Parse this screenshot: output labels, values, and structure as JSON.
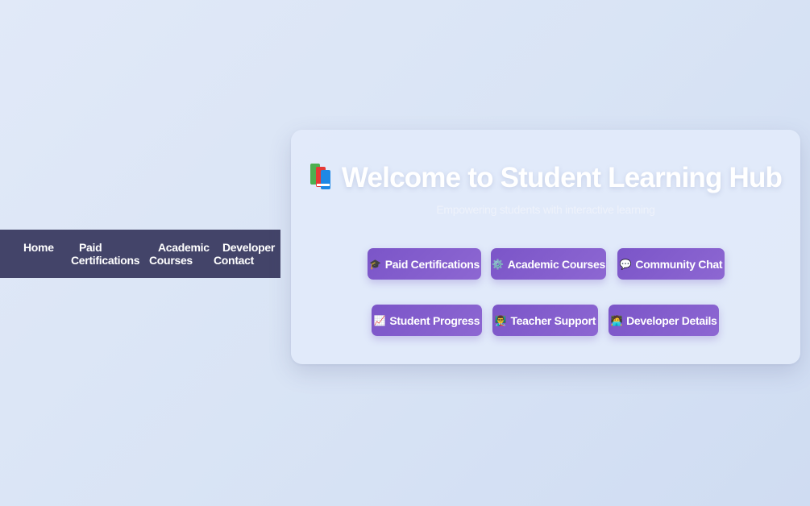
{
  "nav": {
    "home": "Home",
    "paid_line1": "Paid",
    "paid_line2": "Certifications",
    "academic_line1": "Academic",
    "academic_line2": "Courses",
    "developer_line1": "Developer",
    "developer_line2": "Contact"
  },
  "hero": {
    "icon": "books-icon",
    "title": "Welcome to Student Learning Hub",
    "subtitle": "Empowering students with interactive learning"
  },
  "buttons": [
    {
      "label": "Paid Certifications",
      "icon": "graduation-cap-icon",
      "glyph": "🎓"
    },
    {
      "label": "Academic Courses",
      "icon": "gear-icon",
      "glyph": "⚙️"
    },
    {
      "label": "Community Chat",
      "icon": "speech-bubble-icon",
      "glyph": "💬"
    },
    {
      "label": "Student Progress",
      "icon": "chart-increasing-icon",
      "glyph": "📈"
    },
    {
      "label": "Teacher Support",
      "icon": "teacher-icon",
      "glyph": "👨‍🏫"
    },
    {
      "label": "Developer Details",
      "icon": "technologist-icon",
      "glyph": "🧑‍💻"
    }
  ],
  "colors": {
    "navbar": "#434469",
    "button": "#7b55c8",
    "background": "#dde6f6"
  }
}
